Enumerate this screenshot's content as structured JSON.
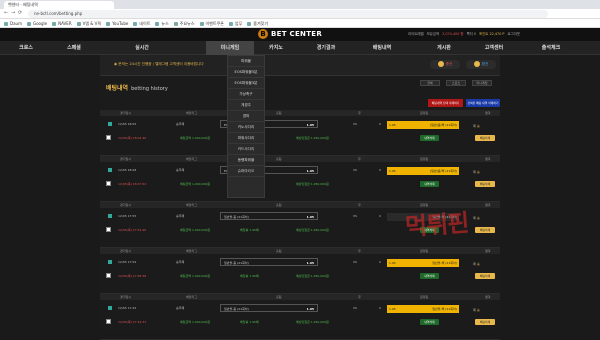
{
  "browser": {
    "tab_title": "벳센터 - 배팅내역",
    "url": "ne-bctl.com/betting.php",
    "back": "←",
    "forward": "→",
    "reload": "⟳",
    "bookmarks": [
      "Daum",
      "Google",
      "NAVER",
      "V앱 & V픽",
      "YouTube",
      "네이트",
      "뉴스",
      "주요뉴스",
      "이벤트쿠폰",
      "업무",
      "즐겨찾기"
    ]
  },
  "site": {
    "logo_mark": "B",
    "logo_text": "BET CENTER",
    "userinfo": [
      {
        "text": "라이트레벨",
        "style": "normal"
      },
      {
        "text": "보유금액",
        "style": "normal"
      },
      {
        "text": "2,074,400 원",
        "style": "red"
      },
      {
        "text": "쪽지 0",
        "style": "normal"
      },
      {
        "text": "포인트 22,470 P",
        "style": "hl"
      },
      {
        "text": "로그아웃",
        "style": "normal"
      }
    ]
  },
  "nav": [
    "크로스",
    "스페셜",
    "실시간",
    "미니게임",
    "카지노",
    "경기결과",
    "배팅내역",
    "게시판",
    "고객센터",
    "출석체크"
  ],
  "dropdown": [
    "파워볼",
    "EOS파워볼5분",
    "EOS파워볼3분",
    "가상축구",
    "개경주",
    "경마",
    "키노사다리",
    "파워사다리",
    "카드사다리",
    "동행파워볼",
    "슈퍼마리오"
  ],
  "notice": "◉ 문의는 24시간 진행중 / 텔레그램 고객센터 이용바랍니다",
  "pills": {
    "charge": "충전",
    "exchange": "환전"
  },
  "section": {
    "title": "배팅내역",
    "subtitle": "betting history",
    "tabs": [
      "전체",
      "스포츠",
      "미니게임"
    ],
    "select_delete": "배팅내역 선택 삭제하기",
    "select_all": "선택된 배팅 내역 삭제하기"
  },
  "columns": [
    "경기일시",
    "배당리그",
    "홈팀",
    "무",
    "원정팀",
    "결과"
  ],
  "bets": [
    {
      "date": "12/05 18:05",
      "team": "승무패",
      "pick": "EOS파워볼5분",
      "odds": "1.95",
      "draw": "VS",
      "gold_label": "1.95",
      "gold_value": "[일반]홀/짝 (21회차)",
      "mark": "X",
      "result": "패",
      "result_type": "승",
      "footer": [
        "12/05(목) 18:04:40",
        "배팅금액 1,000,000원",
        "배당률 1.95배",
        "예상당첨금 1,950,000원"
      ],
      "green": "내역삭제",
      "yellow": "배팅삭제",
      "gold_dark": false
    },
    {
      "date": "12/05 18:08",
      "team": "승무패",
      "pick": "EOS파워볼5분",
      "odds": "1.95",
      "draw": "VS",
      "gold_label": "1.95",
      "gold_value": "[일반]홀/짝 (21회차)",
      "mark": "X",
      "result": "패",
      "result_type": "승",
      "footer": [
        "12/05(목) 18:07:52",
        "배팅금액 1,000,000원",
        "배당률 1.95배",
        "예상당첨금 1,950,000원"
      ],
      "green": "내역삭제",
      "yellow": "배팅삭제",
      "gold_dark": false
    },
    {
      "date": "12/05 17:55",
      "team": "승무패",
      "pick": "일반볼-홀 (21회차)",
      "odds": "1.95",
      "draw": "VS",
      "gold_label": "",
      "gold_value": "일반볼-짝 (21회차)",
      "mark": "X",
      "result": "패",
      "result_type": "승",
      "footer": [
        "12/05(목) 17:54:46",
        "배팅금액 1,000,000원",
        "배당률 1.95배",
        "예상당첨금 1,950,000원"
      ],
      "green": "내역삭제",
      "yellow": "배팅삭제",
      "gold_dark": true
    },
    {
      "date": "12/05 17:59",
      "team": "승무패",
      "pick": "일반볼-홀 (21회차)",
      "odds": "1.95",
      "draw": "VS",
      "gold_label": "1.95",
      "gold_value": "일반볼-짝 (21회차)",
      "mark": "X",
      "result": "패",
      "result_type": "승",
      "footer": [
        "12/05(목) 17:58:38",
        "배팅금액 1,000,000원",
        "배당률 1.95배",
        "예상당첨금 1,950,000원"
      ],
      "green": "내역삭제",
      "yellow": "배팅삭제",
      "gold_dark": false
    },
    {
      "date": "12/05 17:45",
      "team": "승무패",
      "pick": "일반볼-홀 (21회차)",
      "odds": "1.95",
      "draw": "VS",
      "gold_label": "1.95",
      "gold_value": "일반볼-짝 (21회차)",
      "mark": "X",
      "result": "패",
      "result_type": "승",
      "footer": [
        "12/05(목) 17:44:31",
        "배팅금액 1,000,000원",
        "배당률 1.95배",
        "예상당첨금 1,950,000원"
      ],
      "green": "내역삭제",
      "yellow": "배팅삭제",
      "gold_dark": false
    }
  ],
  "watermark": "먹튀핀",
  "colors": {
    "accent": "#e8b84a",
    "red": "#b01818",
    "blue": "#1a3aa8",
    "green": "#1e6a2a",
    "gold": "#f0b400"
  }
}
